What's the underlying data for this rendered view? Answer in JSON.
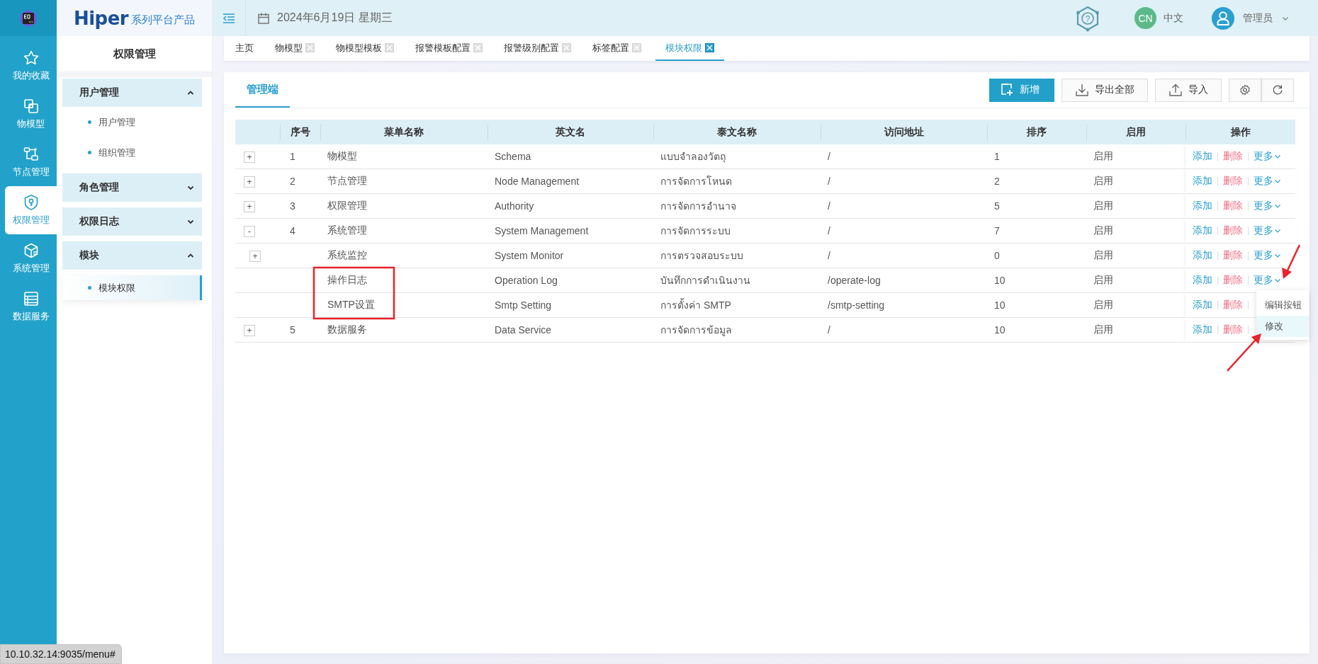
{
  "rail": {
    "items": [
      {
        "label": "我的收藏",
        "selected": false
      },
      {
        "label": "物模型",
        "selected": false
      },
      {
        "label": "节点管理",
        "selected": false
      },
      {
        "label": "权限管理",
        "selected": true
      },
      {
        "label": "系统管理",
        "selected": false
      },
      {
        "label": "数据服务",
        "selected": false
      }
    ]
  },
  "sidebar": {
    "brand": {
      "name": "Hiper",
      "suffix": "系列平台产品"
    },
    "title": "权限管理",
    "groups": [
      {
        "label": "用户管理",
        "expanded": true,
        "children": [
          {
            "label": "用户管理",
            "selected": false
          },
          {
            "label": "组织管理",
            "selected": false
          }
        ]
      },
      {
        "label": "角色管理",
        "expanded": false
      },
      {
        "label": "权限日志",
        "expanded": false
      },
      {
        "label": "模块",
        "expanded": true,
        "children": [
          {
            "label": "模块权限",
            "selected": true
          }
        ]
      }
    ]
  },
  "topbar": {
    "date": "2024年6月19日 星期三",
    "help": {
      "symbol": "?"
    },
    "language": {
      "badge": "CN",
      "label": "中文"
    },
    "user": {
      "name": "管理员"
    }
  },
  "tabs": [
    {
      "label": "主页",
      "selected": false,
      "closable": false
    },
    {
      "label": "物模型",
      "selected": false,
      "closable": true
    },
    {
      "label": "物模型模板",
      "selected": false,
      "closable": true
    },
    {
      "label": "报警模板配置",
      "selected": false,
      "closable": true
    },
    {
      "label": "报警级别配置",
      "selected": false,
      "closable": true
    },
    {
      "label": "标签配置",
      "selected": false,
      "closable": true
    },
    {
      "label": "模块权限",
      "selected": true,
      "closable": true
    }
  ],
  "panel": {
    "subtabs": [
      {
        "label": "管理端",
        "selected": true
      }
    ],
    "toolbar": [
      {
        "kind": "add",
        "label": "新增",
        "primary": true
      },
      {
        "kind": "export",
        "label": "导出全部",
        "primary": false
      },
      {
        "kind": "import",
        "label": "导入",
        "primary": false
      },
      {
        "kind": "settings",
        "primary": false
      },
      {
        "kind": "refresh",
        "primary": false
      }
    ]
  },
  "table": {
    "columns": [
      "序号",
      "菜单名称",
      "英文名",
      "泰文名称",
      "访问地址",
      "排序",
      "启用",
      "操作"
    ],
    "rows": [
      {
        "expander": "+",
        "number": "1",
        "name": "物模型",
        "english": "Schema",
        "thai": "แบบจำลองวัตถุ",
        "path": "/",
        "order": "1",
        "enabled": "启用",
        "actions": [
          "添加",
          "删除",
          "更多"
        ]
      },
      {
        "expander": "+",
        "number": "2",
        "name": "节点管理",
        "english": "Node Management",
        "thai": "การจัดการโหนด",
        "path": "/",
        "order": "2",
        "enabled": "启用",
        "actions": [
          "添加",
          "删除",
          "更多"
        ]
      },
      {
        "expander": "+",
        "number": "3",
        "name": "权限管理",
        "english": "Authority",
        "thai": "การจัดการอำนาจ",
        "path": "/",
        "order": "5",
        "enabled": "启用",
        "actions": [
          "添加",
          "删除",
          "更多"
        ]
      },
      {
        "expander": "-",
        "number": "4",
        "name": "系统管理",
        "english": "System Management",
        "thai": "การจัดการระบบ",
        "path": "/",
        "order": "7",
        "enabled": "启用",
        "actions": [
          "添加",
          "删除",
          "更多"
        ],
        "children": [
          {
            "expander": "+",
            "name": "系统监控",
            "english": "System Monitor",
            "thai": "การตรวจสอบระบบ",
            "path": "/",
            "order": "0",
            "enabled": "启用",
            "actions": [
              "添加",
              "删除",
              "更多"
            ]
          },
          {
            "name": "操作日志",
            "english": "Operation Log",
            "thai": "บันทึกการดำเนินงาน",
            "path": "/operate-log",
            "order": "10",
            "enabled": "启用",
            "actions": [
              "添加",
              "删除",
              "更多"
            ]
          },
          {
            "name": "SMTP设置",
            "english": "Smtp Setting",
            "thai": "การตั้งค่า SMTP",
            "path": "/smtp-setting",
            "order": "10",
            "enabled": "启用",
            "actions": [
              "添加",
              "删除"
            ]
          }
        ]
      },
      {
        "expander": "+",
        "number": "5",
        "name": "数据服务",
        "english": "Data Service",
        "thai": "การจัดการข้อมูล",
        "path": "/",
        "order": "10",
        "enabled": "启用",
        "actions": [
          "添加",
          "删除"
        ]
      }
    ]
  },
  "more_menu": {
    "items": [
      {
        "label": "编辑按钮",
        "hovered": false
      },
      {
        "label": "修改",
        "hovered": true
      }
    ]
  },
  "status_url": "10.10.32.14:9035/menu#"
}
